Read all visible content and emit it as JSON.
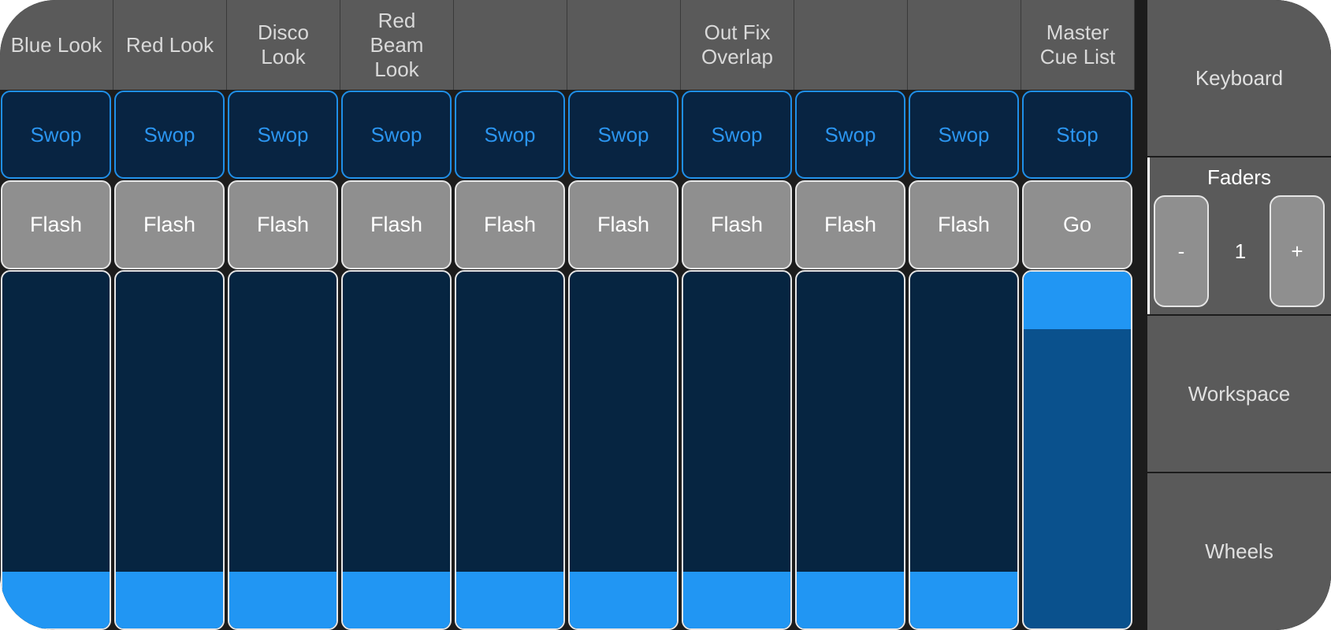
{
  "playbacks": [
    {
      "name": "Blue Look",
      "top_button": "Swop",
      "bottom_button": "Flash",
      "level": 0.15
    },
    {
      "name": "Red Look",
      "top_button": "Swop",
      "bottom_button": "Flash",
      "level": 0.15
    },
    {
      "name": "Disco\nLook",
      "top_button": "Swop",
      "bottom_button": "Flash",
      "level": 0.15
    },
    {
      "name": "Red\nBeam\nLook",
      "top_button": "Swop",
      "bottom_button": "Flash",
      "level": 0.15
    },
    {
      "name": "",
      "top_button": "Swop",
      "bottom_button": "Flash",
      "level": 0.15
    },
    {
      "name": "",
      "top_button": "Swop",
      "bottom_button": "Flash",
      "level": 0.15
    },
    {
      "name": "Out Fix\nOverlap",
      "top_button": "Swop",
      "bottom_button": "Flash",
      "level": 0.15
    },
    {
      "name": "",
      "top_button": "Swop",
      "bottom_button": "Flash",
      "level": 0.15
    },
    {
      "name": "",
      "top_button": "Swop",
      "bottom_button": "Flash",
      "level": 0.15
    },
    {
      "name": "Master\nCue List",
      "top_button": "Stop",
      "bottom_button": "Go",
      "level": 0.85,
      "master": true
    }
  ],
  "side": {
    "keyboard": "Keyboard",
    "faders_title": "Faders",
    "minus": "-",
    "page": "1",
    "plus": "+",
    "workspace": "Workspace",
    "wheels": "Wheels"
  },
  "colors": {
    "header_bg": "#5a5a5a",
    "swop_text": "#2b95f0",
    "fader_fill": "#2196f3",
    "fader_bg": "#062541",
    "flash_bg": "#8f8f8f"
  }
}
